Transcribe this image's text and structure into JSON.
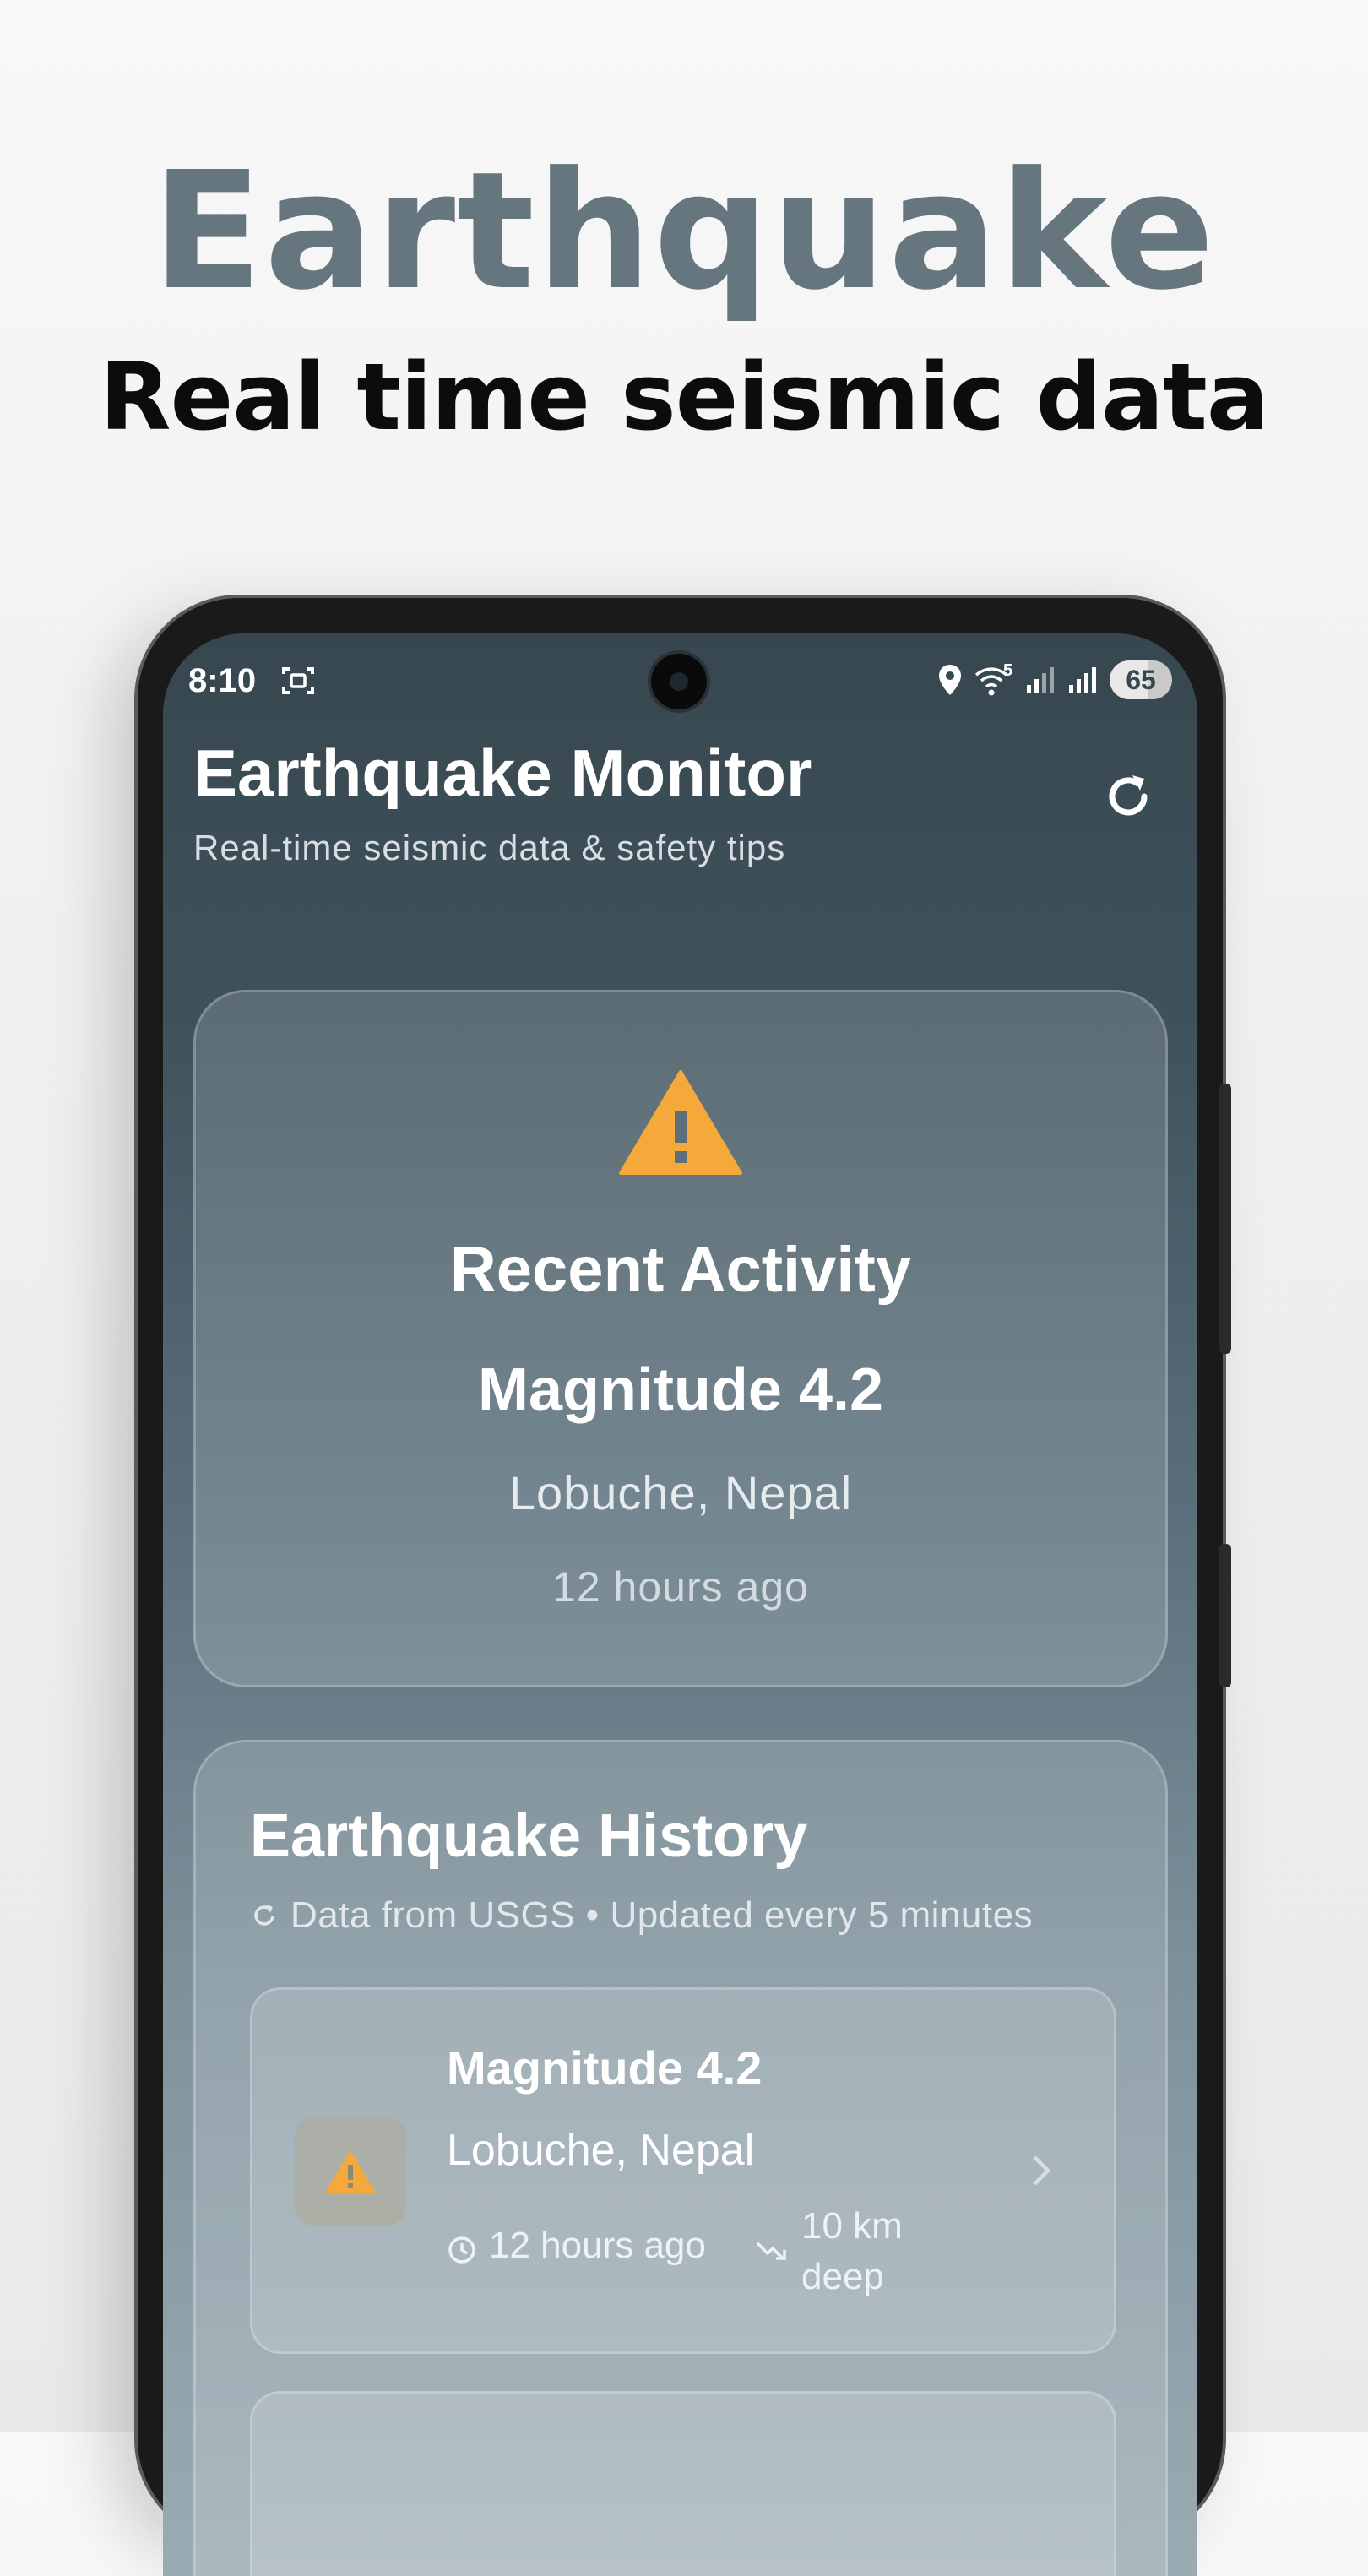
{
  "promo": {
    "title": "Earthquake",
    "subtitle": "Real time seismic data"
  },
  "status_bar": {
    "time": "8:10",
    "battery": "65",
    "wifi_label": "5",
    "icons": [
      "screenshot-icon",
      "location-icon",
      "wifi-icon",
      "signal-icon",
      "signal-icon",
      "battery-icon"
    ]
  },
  "header": {
    "title": "Earthquake Monitor",
    "subtitle": "Real-time seismic data & safety tips",
    "refresh_icon": "refresh-icon"
  },
  "recent_activity": {
    "icon": "warning-icon",
    "title": "Recent Activity",
    "magnitude": "Magnitude 4.2",
    "location": "Lobuche, Nepal",
    "time": "12 hours ago"
  },
  "history": {
    "title": "Earthquake History",
    "meta": "Data from USGS • Updated every 5 minutes",
    "items": [
      {
        "magnitude": "Magnitude 4.2",
        "location": "Lobuche, Nepal",
        "time": "12 hours ago",
        "depth": "10 km deep"
      }
    ]
  },
  "colors": {
    "title_gray": "#66767f",
    "warning_orange": "#f5a93b",
    "app_bg_top": "#37474f"
  }
}
